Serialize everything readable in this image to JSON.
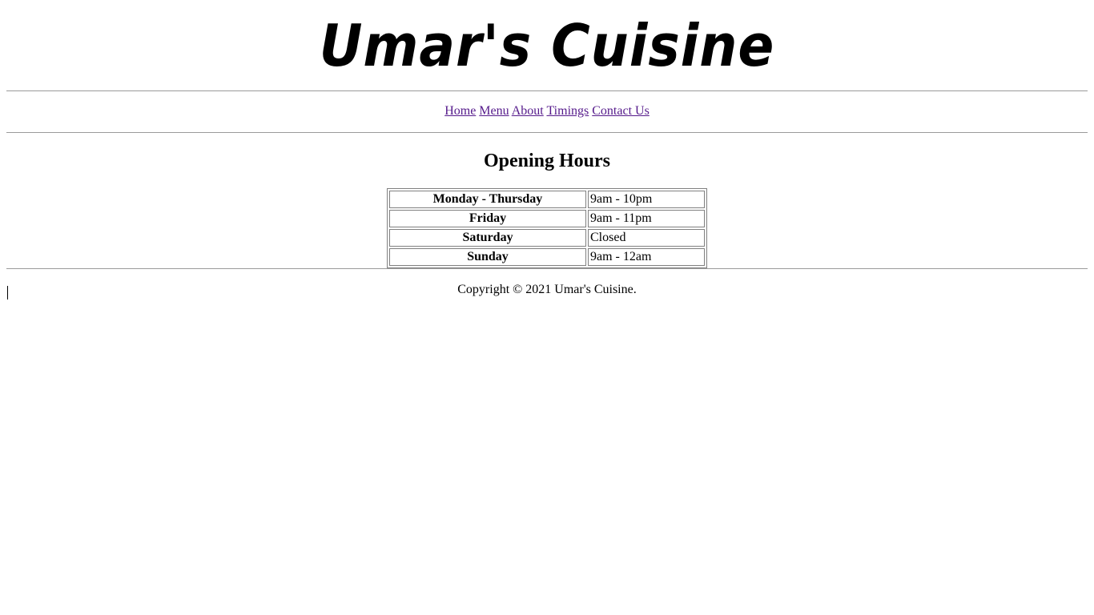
{
  "header": {
    "logo_text": "Umar's Cuisine"
  },
  "nav": {
    "items": [
      {
        "label": "Home"
      },
      {
        "label": "Menu"
      },
      {
        "label": "About"
      },
      {
        "label": "Timings"
      },
      {
        "label": "Contact Us"
      }
    ]
  },
  "main": {
    "title": "Opening Hours",
    "hours": [
      {
        "day": "Monday - Thursday",
        "time": "9am - 10pm"
      },
      {
        "day": "Friday",
        "time": "9am - 11pm"
      },
      {
        "day": "Saturday",
        "time": "Closed"
      },
      {
        "day": "Sunday",
        "time": "9am - 12am"
      }
    ]
  },
  "footer": {
    "copyright": "Copyright © 2021 Umar's Cuisine."
  },
  "colors": {
    "link_visited": "#551a8b",
    "rule": "#9a9a9a",
    "table_border": "#808080"
  }
}
